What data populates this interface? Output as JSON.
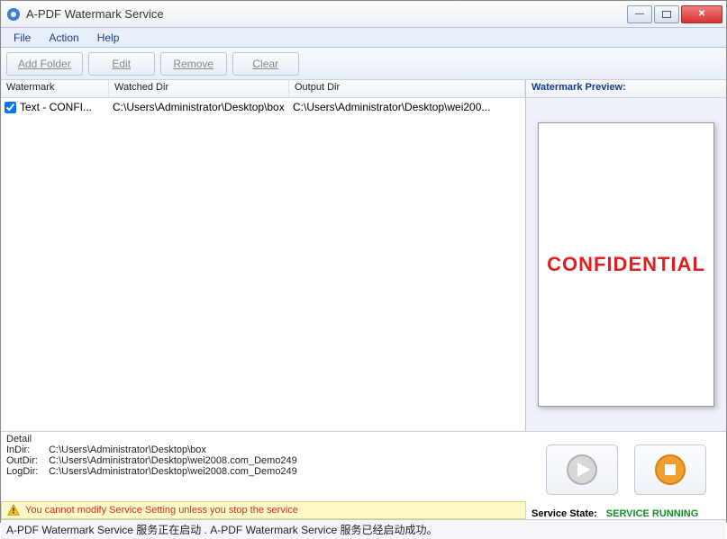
{
  "window": {
    "title": "A-PDF Watermark Service"
  },
  "menu": {
    "file": "File",
    "action": "Action",
    "help": "Help"
  },
  "toolbar": {
    "add_folder": "Add Folder",
    "edit": "Edit",
    "remove": "Remove",
    "clear": "Clear"
  },
  "table": {
    "headers": {
      "watermark": "Watermark",
      "watched_dir": "Watched Dir",
      "output_dir": "Output Dir"
    },
    "rows": [
      {
        "checked": true,
        "watermark": "Text - CONFI...",
        "watched_dir": "C:\\Users\\Administrator\\Desktop\\box",
        "output_dir": "C:\\Users\\Administrator\\Desktop\\wei200..."
      }
    ]
  },
  "preview": {
    "title": "Watermark Preview:",
    "watermark_text": "CONFIDENTIAL"
  },
  "detail": {
    "title": "Detail",
    "indir_label": "InDir:",
    "indir": "C:\\Users\\Administrator\\Desktop\\box",
    "outdir_label": "OutDir:",
    "outdir": "C:\\Users\\Administrator\\Desktop\\wei2008.com_Demo249",
    "logdir_label": "LogDir:",
    "logdir": "C:\\Users\\Administrator\\Desktop\\wei2008.com_Demo249"
  },
  "warning": {
    "text": "You cannot modify Service Setting unless you stop the service"
  },
  "service": {
    "state_label": "Service State:",
    "state_value": "SERVICE RUNNING"
  },
  "statusbar": {
    "text": "A-PDF Watermark Service 服务正在启动 .  A-PDF Watermark Service 服务已经启动成功。"
  }
}
